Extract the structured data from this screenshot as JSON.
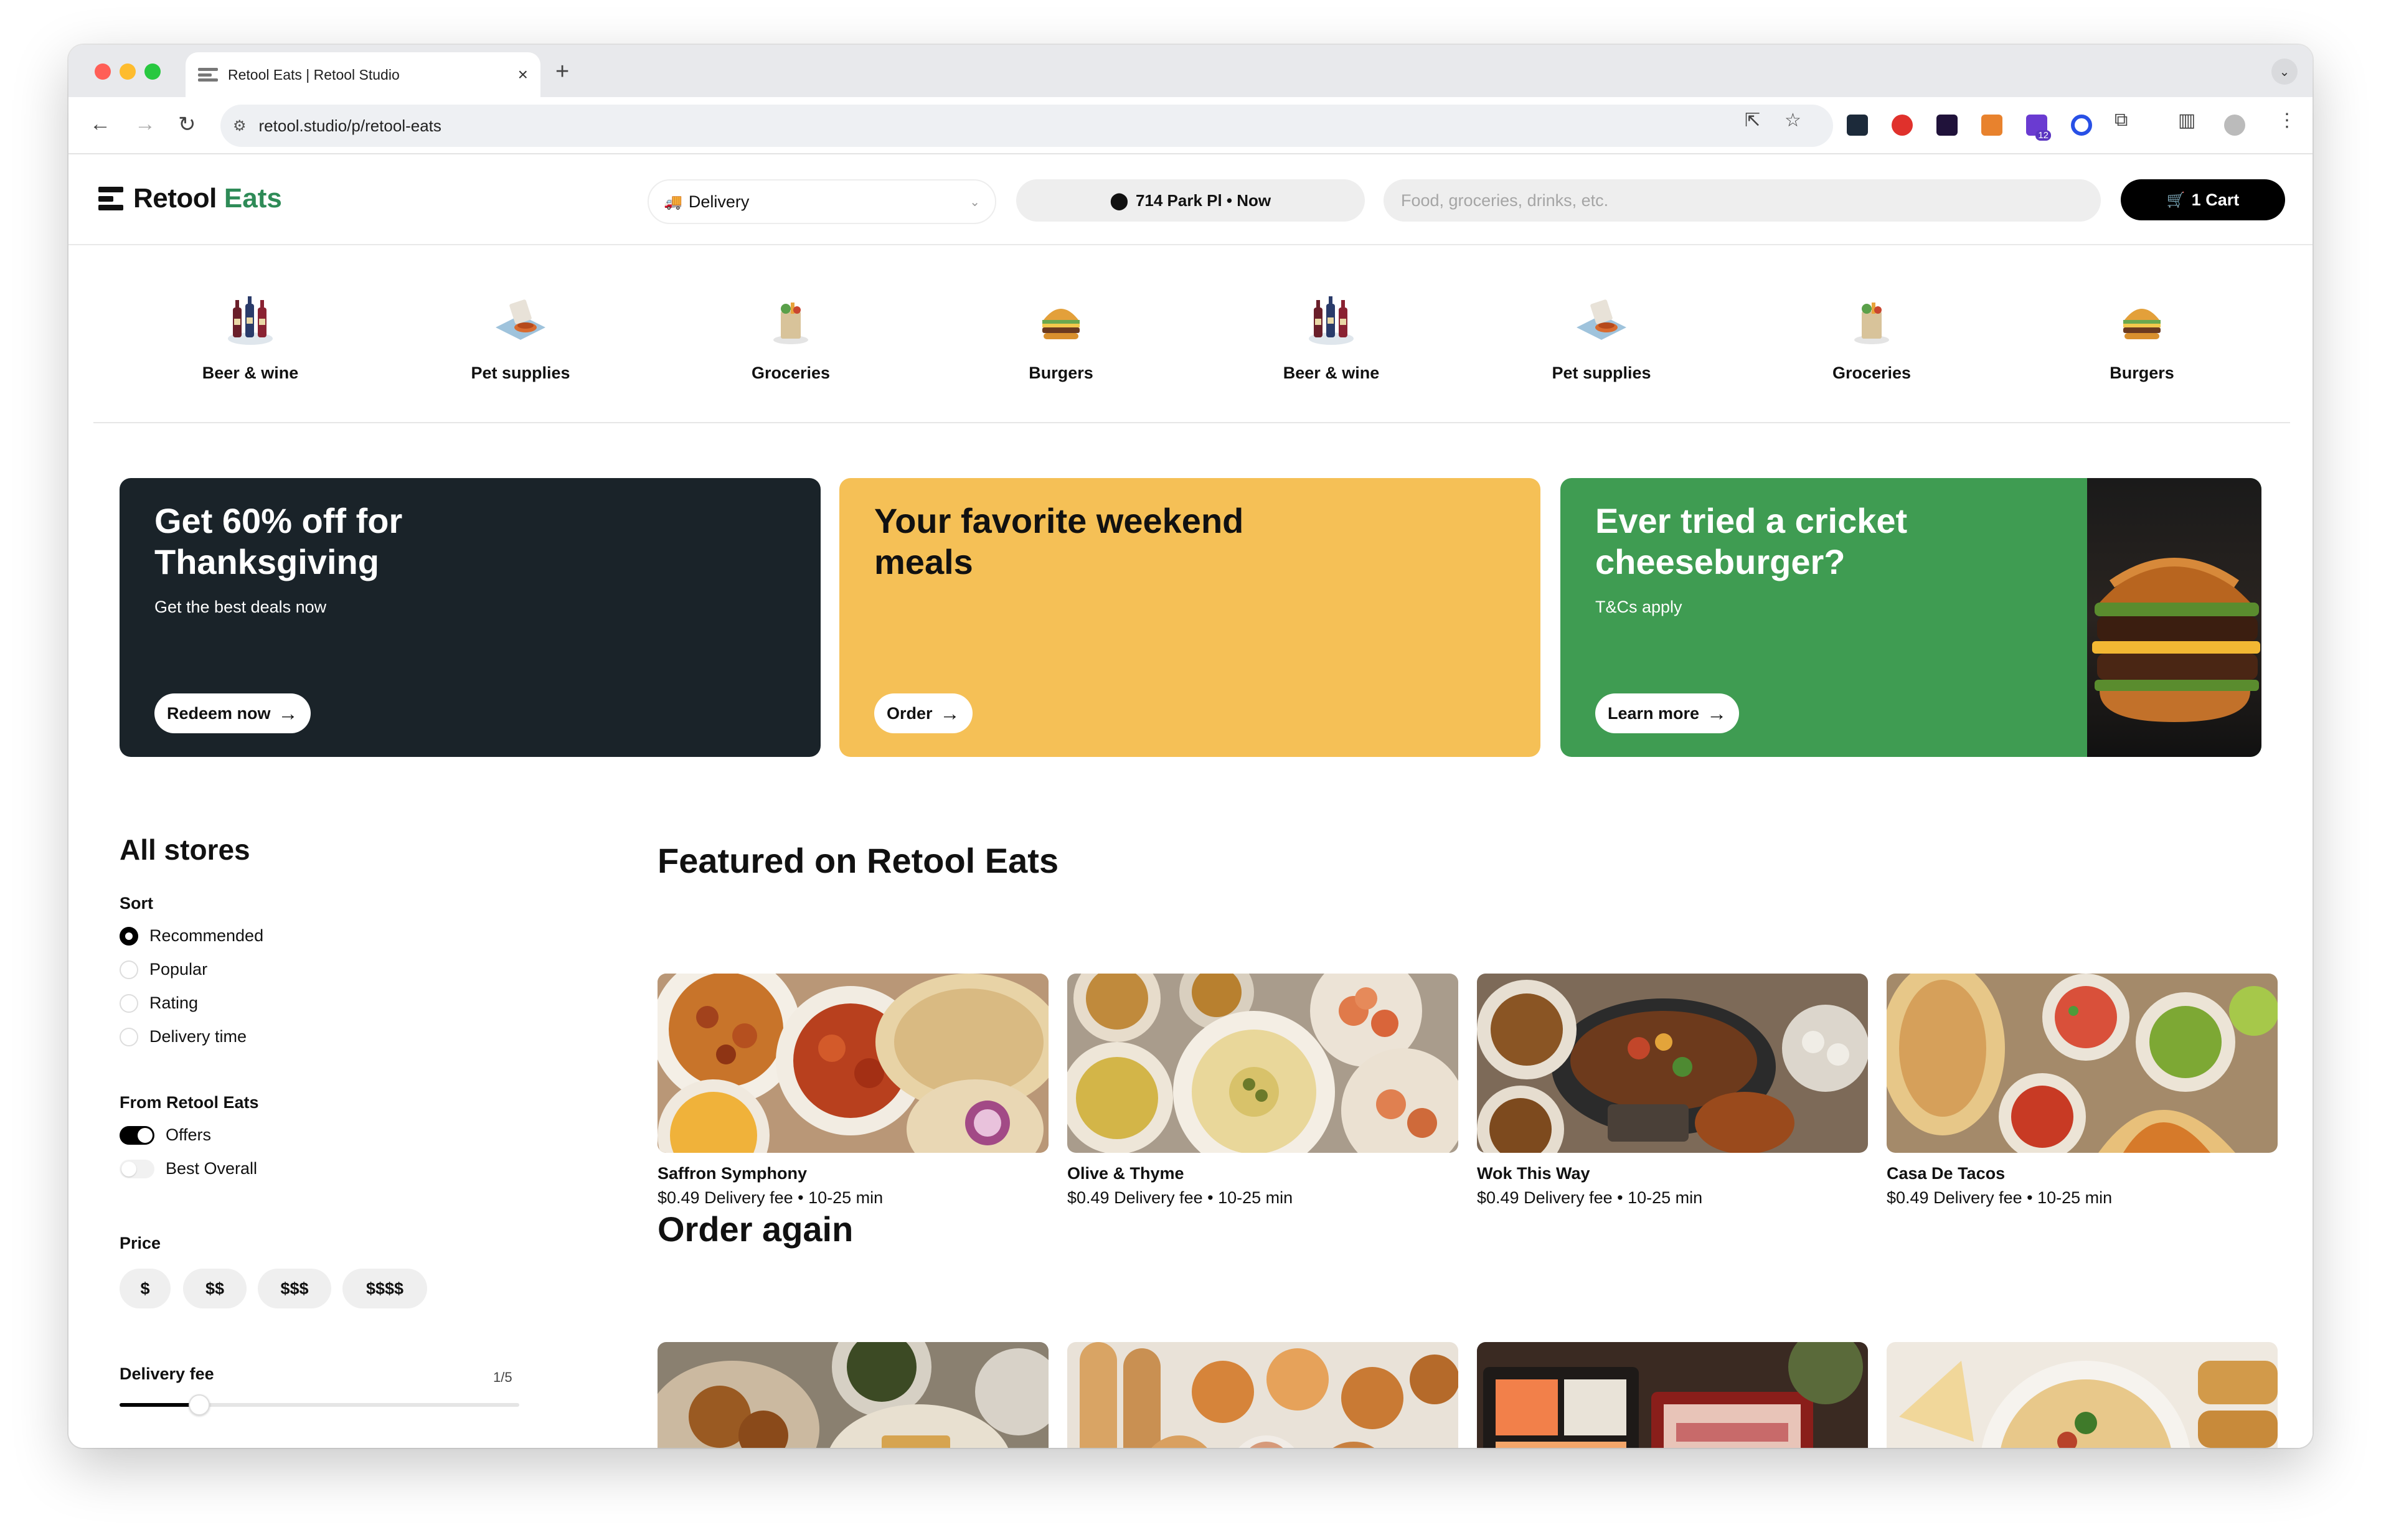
{
  "browser": {
    "tab_title": "Retool Eats | Retool Studio",
    "url": "retool.studio/p/retool-eats",
    "ext_badge": "12"
  },
  "header": {
    "brand_primary": "Retool",
    "brand_secondary": "Eats",
    "delivery_mode": "Delivery",
    "location": "714 Park Pl • Now",
    "search_placeholder": "Food, groceries, drinks, etc.",
    "cart_label": "1 Cart"
  },
  "categories": [
    {
      "label": "Beer & wine",
      "icon": "wine-bottles-icon"
    },
    {
      "label": "Pet supplies",
      "icon": "pet-bowl-icon"
    },
    {
      "label": "Groceries",
      "icon": "grocery-bag-icon"
    },
    {
      "label": "Burgers",
      "icon": "burger-icon"
    },
    {
      "label": "Beer & wine",
      "icon": "wine-bottles-icon"
    },
    {
      "label": "Pet supplies",
      "icon": "pet-bowl-icon"
    },
    {
      "label": "Groceries",
      "icon": "grocery-bag-icon"
    },
    {
      "label": "Burgers",
      "icon": "burger-icon"
    }
  ],
  "promos": [
    {
      "title": "Get 60% off for Thanksgiving",
      "subtitle": "Get the best deals now",
      "cta": "Redeem now",
      "bg": "#1a2329",
      "fg": "#ffffff"
    },
    {
      "title": "Your favorite weekend meals",
      "subtitle": "",
      "cta": "Order",
      "bg": "#f5c056",
      "fg": "#111111"
    },
    {
      "title": "Ever tried a cricket cheeseburger?",
      "subtitle": "T&Cs apply",
      "cta": "Learn more",
      "bg": "#3f9c52",
      "fg": "#ffffff"
    }
  ],
  "sidebar": {
    "title": "All stores",
    "sort_label": "Sort",
    "sort_options": [
      "Recommended",
      "Popular",
      "Rating",
      "Delivery time"
    ],
    "sort_selected": "Recommended",
    "from_label": "From Retool Eats",
    "toggles": [
      {
        "label": "Offers",
        "on": true
      },
      {
        "label": "Best Overall",
        "on": false
      }
    ],
    "price_label": "Price",
    "prices": [
      "$",
      "$$",
      "$$$",
      "$$$$"
    ],
    "delivery_fee_label": "Delivery fee",
    "delivery_fee_value": "1/5",
    "delivery_fee_level": 0.2
  },
  "featured": {
    "title": "Featured on Retool Eats",
    "stores": [
      {
        "name": "Saffron Symphony",
        "meta": "$0.49 Delivery fee • 10-25 min"
      },
      {
        "name": "Olive & Thyme",
        "meta": "$0.49 Delivery fee • 10-25 min"
      },
      {
        "name": "Wok This Way",
        "meta": "$0.49 Delivery fee • 10-25 min"
      },
      {
        "name": "Casa De Tacos",
        "meta": "$0.49 Delivery fee • 10-25 min"
      }
    ]
  },
  "order_again": {
    "title": "Order again"
  },
  "colors": {
    "brand_green": "#2e8b57",
    "dark": "#1a2329",
    "yellow": "#f5c056",
    "green": "#3f9c52"
  }
}
